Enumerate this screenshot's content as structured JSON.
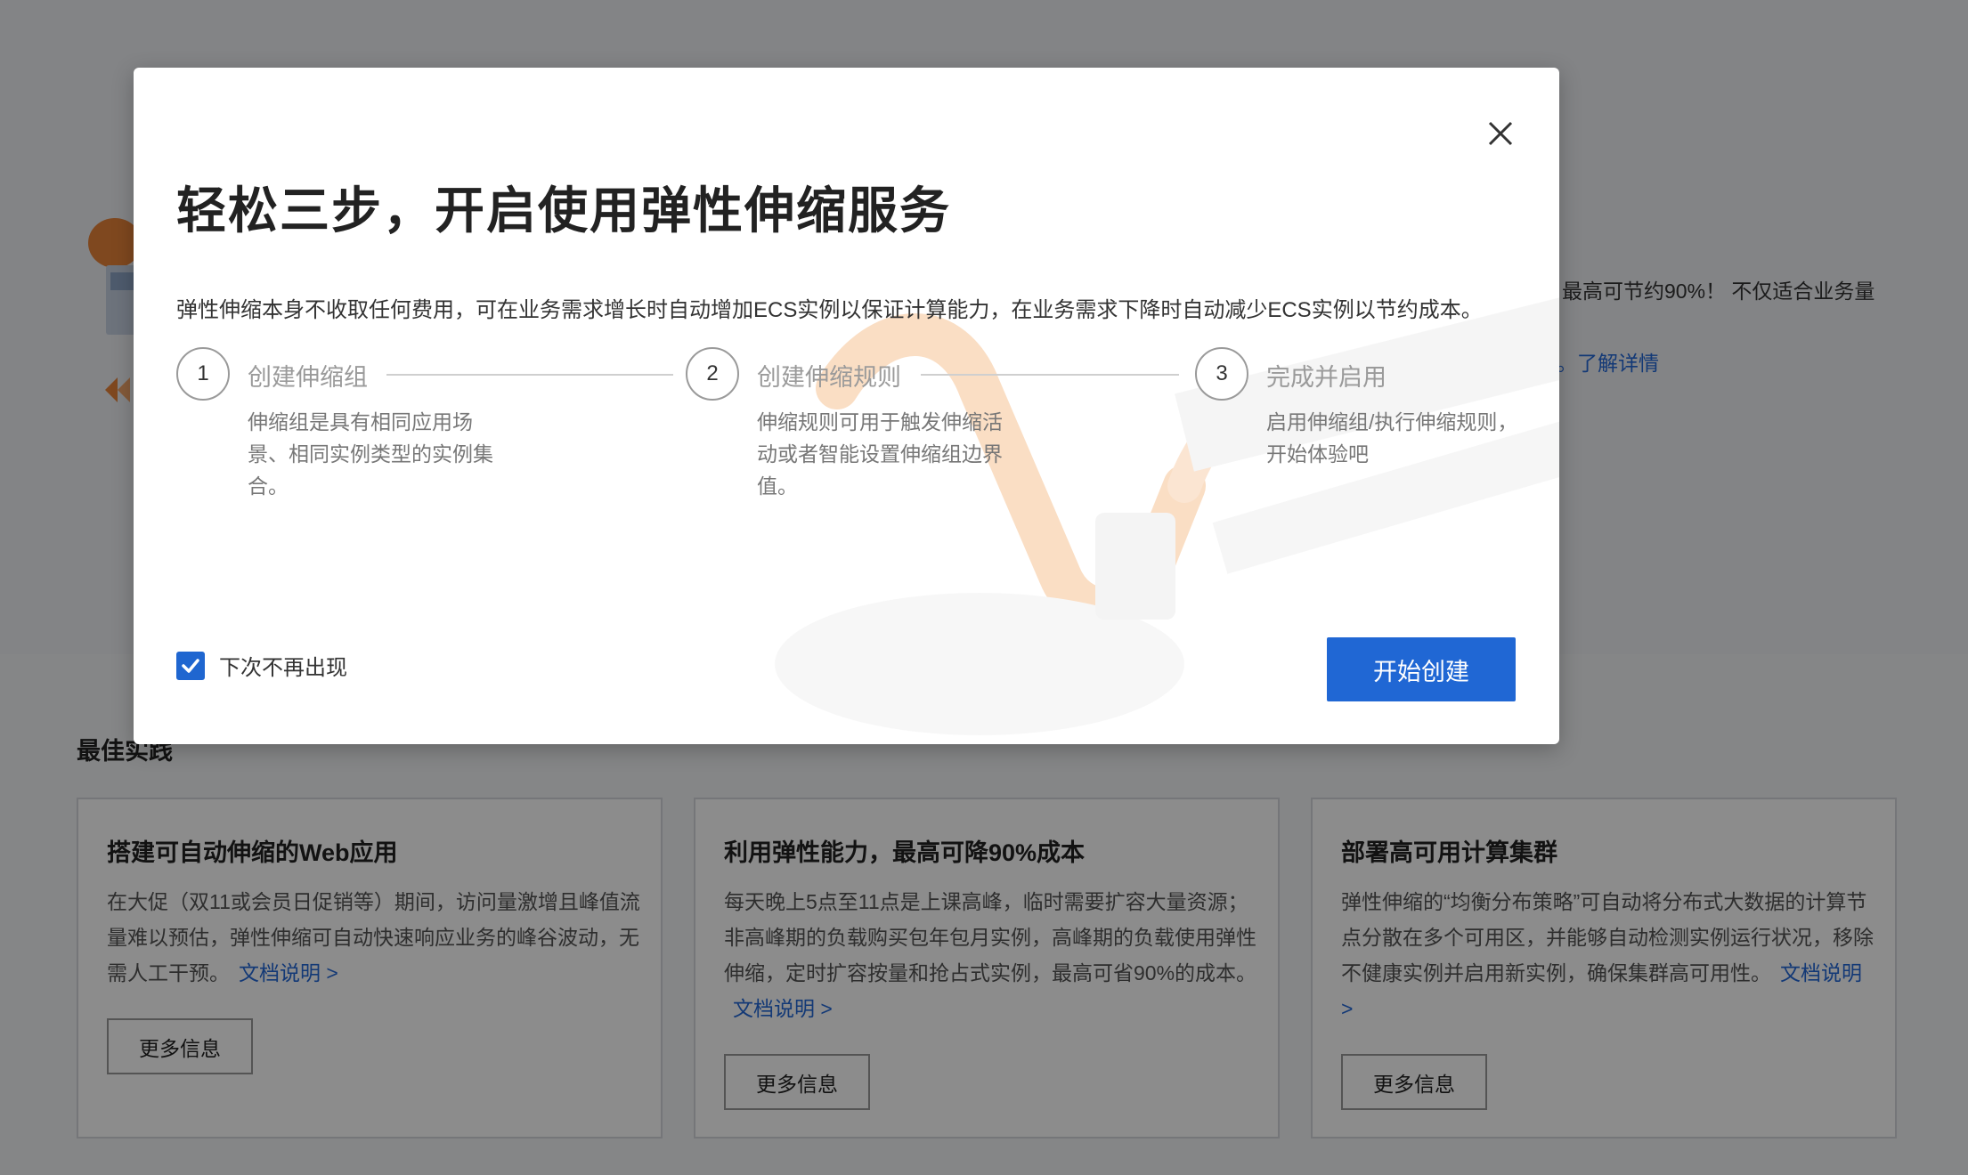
{
  "background": {
    "hero_text": "最高可节约90%！ 不仅适合业务量",
    "hero_link": "。了解详情",
    "section_title": "最佳实践",
    "cards": [
      {
        "title": "搭建可自动伸缩的Web应用",
        "desc": "在大促（双11或会员日促销等）期间，访问量激增且峰值流量难以预估，弹性伸缩可自动快速响应业务的峰谷波动，无需人工干预。",
        "link": "文档说明 >",
        "button": "更多信息"
      },
      {
        "title": "利用弹性能力，最高可降90%成本",
        "desc": "每天晚上5点至11点是上课高峰，临时需要扩容大量资源；非高峰期的负载购买包年包月实例，高峰期的负载使用弹性伸缩，定时扩容按量和抢占式实例，最高可省90%的成本。",
        "link": "文档说明 >",
        "button": "更多信息"
      },
      {
        "title": "部署高可用计算集群",
        "desc": "弹性伸缩的“均衡分布策略”可自动将分布式大数据的计算节点分散在多个可用区，并能够自动检测实例运行状况，移除不健康实例并启用新实例，确保集群高可用性。",
        "link": "文档说明 >",
        "button": "更多信息"
      }
    ]
  },
  "modal": {
    "title": "轻松三步，开启使用弹性伸缩服务",
    "description": "弹性伸缩本身不收取任何费用，可在业务需求增长时自动增加ECS实例以保证计算能力，在业务需求下降时自动减少ECS实例以节约成本。",
    "steps": [
      {
        "number": "1",
        "label": "创建伸缩组",
        "desc": "伸缩组是具有相同应用场景、相同实例类型的实例集合。"
      },
      {
        "number": "2",
        "label": "创建伸缩规则",
        "desc": "伸缩规则可用于触发伸缩活动或者智能设置伸缩组边界值。"
      },
      {
        "number": "3",
        "label": "完成并启用",
        "desc": "启用伸缩组/执行伸缩规则，开始体验吧"
      }
    ],
    "checkbox": {
      "label": "下次不再出现",
      "checked": true
    },
    "primary_button": "开始创建",
    "close_icon": "close-icon",
    "accent_color": "#2067d4"
  }
}
